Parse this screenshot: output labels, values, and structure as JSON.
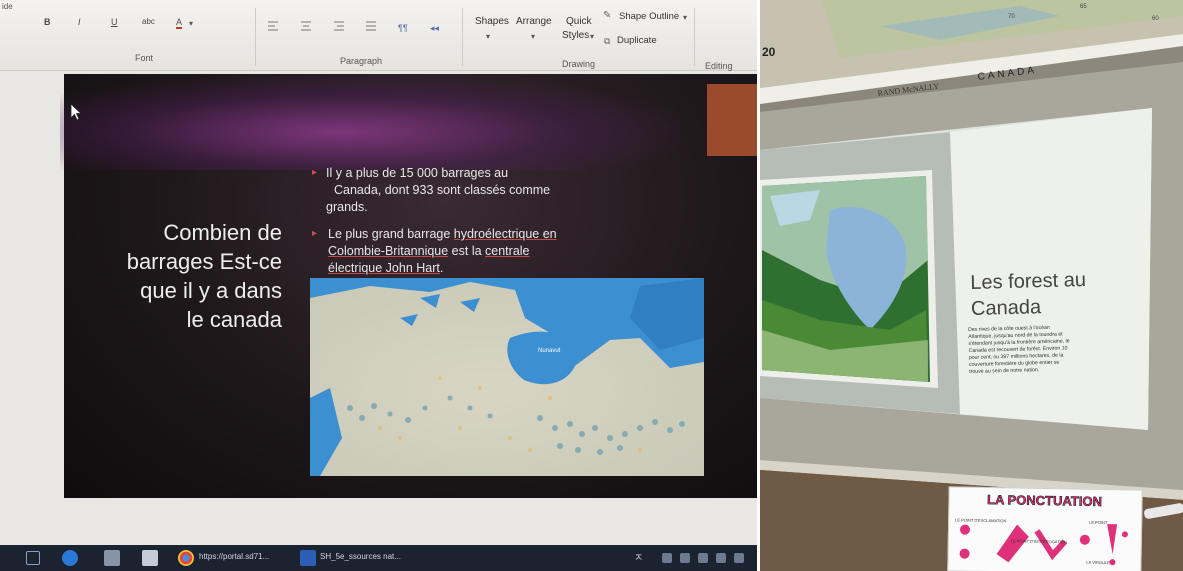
{
  "left": {
    "ribbon": {
      "slide_tab_partial": "ide",
      "font_buttons": {
        "bold": "B",
        "italic": "I",
        "underline": "U",
        "strikethrough": "abc",
        "font_color": "A"
      },
      "groups": {
        "font": "Font",
        "paragraph": "Paragraph",
        "drawing": "Drawing",
        "editing": "Editing"
      },
      "drawing": {
        "shapes": "Shapes",
        "arrange": "Arrange",
        "quick_styles_1": "Quick",
        "quick_styles_2": "Styles",
        "shape_outline": "Shape Outline",
        "duplicate": "Duplicate"
      }
    },
    "slide": {
      "title_lines": [
        "Combien de",
        "barrages Est-ce",
        "que il y a dans",
        "le canada"
      ],
      "bullet1_lines": [
        "Il y a plus de 15 000 barrages au",
        "Canada, dont 933 sont classés comme",
        "grands."
      ],
      "bullet2": {
        "text_a": "Le plus grand barrage ",
        "link_a": "hydroélectrique en",
        "link_b": "Colombie-Britannique",
        "text_b": " est la ",
        "link_c": "centrale",
        "link_d": "électrique John Hart",
        "text_c": "."
      },
      "map_label": "Nunavut"
    },
    "taskbar": {
      "browser_tab": "https://portal.sd71...",
      "word_tab": "SH_5e_ssources nat...",
      "tray_glyph": "ㅈ"
    }
  },
  "right": {
    "wall_map": {
      "brand": "RAND McNALLY",
      "country": "CANADA",
      "numbers": [
        "20",
        "70",
        "65",
        "60"
      ]
    },
    "projector_slide": {
      "title_lines": [
        "Les forest au",
        "Canada"
      ],
      "body_lines": [
        "Des rives de la côte ouest à l'océan",
        "Atlantique, jusqu'au nord de la toundra et",
        "s'étendant jusqu'à la frontière américaine, le",
        "Canada est recouvert de forêst. Environ 10",
        "pour cent, ou 397 millions hectares, de la",
        "couverture forestière du globe entier se",
        "trouve au sein de notre nation."
      ]
    },
    "poster": {
      "title": "LA PONCTUATION",
      "labels": [
        "LE POINT",
        "LA VIRGULE",
        "LE POINT D'EXCLAMATION",
        "LE POINT D'INTERROGATION"
      ]
    }
  },
  "colors": {
    "slide_bg": "#1d1719",
    "slide_glow": "#96409a",
    "bullet_mark": "#d24a5a",
    "taskbar": "#1b2230",
    "projector_slide": "#eef1eb",
    "poster_accent": "#e0307a"
  }
}
